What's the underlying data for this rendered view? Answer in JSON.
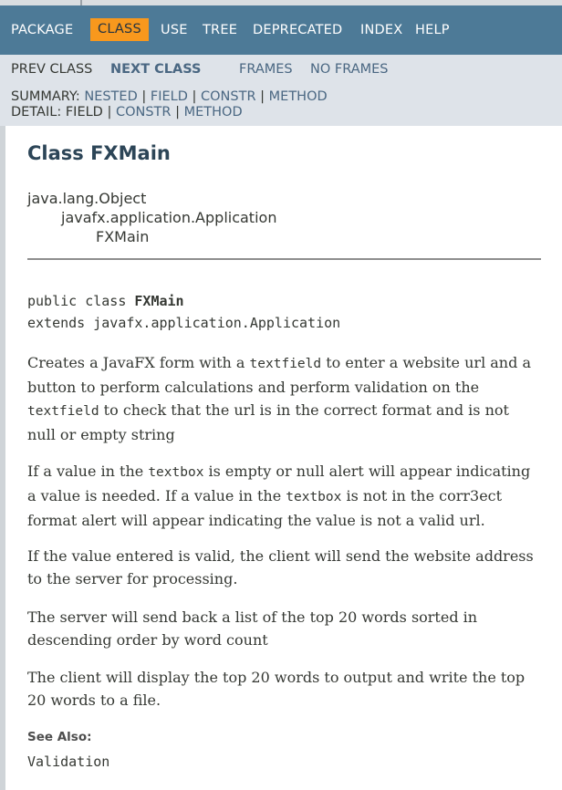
{
  "nav": {
    "package": "PACKAGE",
    "class": "CLASS",
    "use": "USE",
    "tree": "TREE",
    "deprecated": "DEPRECATED",
    "index": "INDEX",
    "help": "HELP"
  },
  "subnav": {
    "prev_class": "PREV CLASS",
    "next_class": "NEXT CLASS",
    "frames": "FRAMES",
    "no_frames": "NO FRAMES",
    "summary_label": "SUMMARY:",
    "summary_nested": "NESTED",
    "summary_field": "FIELD",
    "summary_constr": "CONSTR",
    "summary_method": "METHOD",
    "detail_label": "DETAIL:",
    "detail_field": "FIELD",
    "detail_constr": "CONSTR",
    "detail_method": "METHOD",
    "sep": "|"
  },
  "header": {
    "title": "Class FXMain"
  },
  "inheritance": [
    "java.lang.Object",
    "javafx.application.Application",
    "FXMain"
  ],
  "signature": {
    "prefix": "public class ",
    "name": "FXMain",
    "extends": "extends javafx.application.Application"
  },
  "description": {
    "p1_a": "Creates a JavaFX form with a ",
    "p1_code1": "textfield",
    "p1_b": " to enter a website url and a button to perform calculations and perform validation on the ",
    "p1_code2": "textfield",
    "p1_c": " to check that the url is in the correct format and is not null or empty string",
    "p2_a": "If a value in the ",
    "p2_code1": "textbox",
    "p2_b": " is empty or null alert will appear indicating a value is needed. If a value in the ",
    "p2_code2": "textbox",
    "p2_c": " is not in the corr3ect format alert will appear indicating the value is not a valid url.",
    "p3": "If the value entered is valid, the client will send the website address to the server for processing.",
    "p4": "The server will send back a list of the top 20 words sorted in descending order by word count",
    "p5": "The client will display the top 20 words to output and write the top 20 words to a file."
  },
  "see_also": {
    "label": "See Also:",
    "link": "Validation"
  }
}
